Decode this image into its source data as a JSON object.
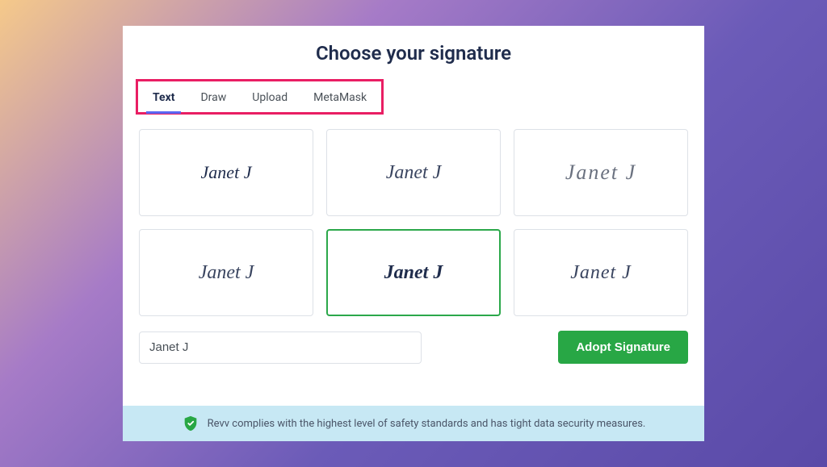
{
  "modal": {
    "title": "Choose your signature"
  },
  "tabs": [
    {
      "label": "Text",
      "active": true
    },
    {
      "label": "Draw",
      "active": false
    },
    {
      "label": "Upload",
      "active": false
    },
    {
      "label": "MetaMask",
      "active": false
    }
  ],
  "signatures": [
    {
      "text": "Janet J",
      "style": "serif-italic",
      "selected": false
    },
    {
      "text": "Janet J",
      "style": "script-light",
      "selected": false
    },
    {
      "text": "Janet J",
      "style": "script-thin",
      "selected": false
    },
    {
      "text": "Janet J",
      "style": "script-flowing",
      "selected": false
    },
    {
      "text": "Janet J",
      "style": "script-bold",
      "selected": true
    },
    {
      "text": "Janet J",
      "style": "script-slant",
      "selected": false
    }
  ],
  "input": {
    "value": "Janet J"
  },
  "actions": {
    "adopt_label": "Adopt Signature"
  },
  "security": {
    "message": "Revv complies with the highest level of safety standards and has tight data security measures."
  },
  "colors": {
    "highlight_border": "#e91e63",
    "active_underline": "#5966f3",
    "selected_border": "#2ba84a",
    "primary_button": "#28a745",
    "security_bar": "#c7e8f4"
  }
}
